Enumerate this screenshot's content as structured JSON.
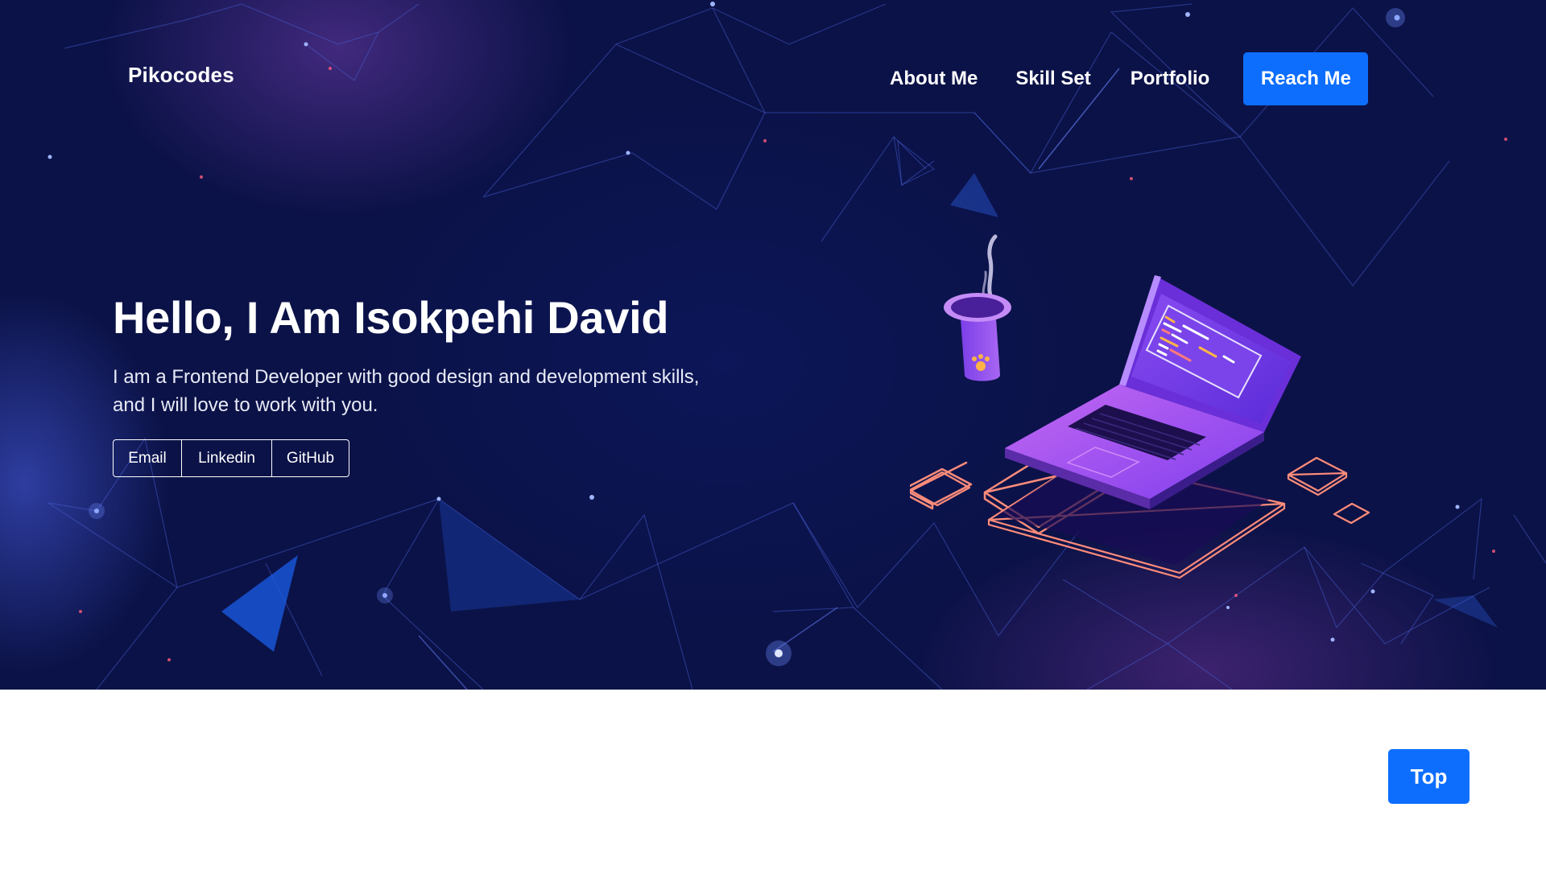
{
  "navbar": {
    "brand": "Pikocodes",
    "links": [
      {
        "label": "About Me"
      },
      {
        "label": "Skill Set"
      },
      {
        "label": "Portfolio"
      }
    ],
    "cta_label": "Reach Me"
  },
  "hero": {
    "title": "Hello, I Am Isokpehi David",
    "subtitle": "I am a Frontend Developer with good design and development skills, and I will love to work with you.",
    "social_buttons": [
      {
        "label": "Email"
      },
      {
        "label": "Linkedin"
      },
      {
        "label": "GitHub"
      }
    ],
    "illustration": "laptop-with-coffee-cup-illustration"
  },
  "scroll_top_label": "Top",
  "colors": {
    "primary": "#0d6efd",
    "hero_background": "#0b1247",
    "text": "#ffffff"
  }
}
